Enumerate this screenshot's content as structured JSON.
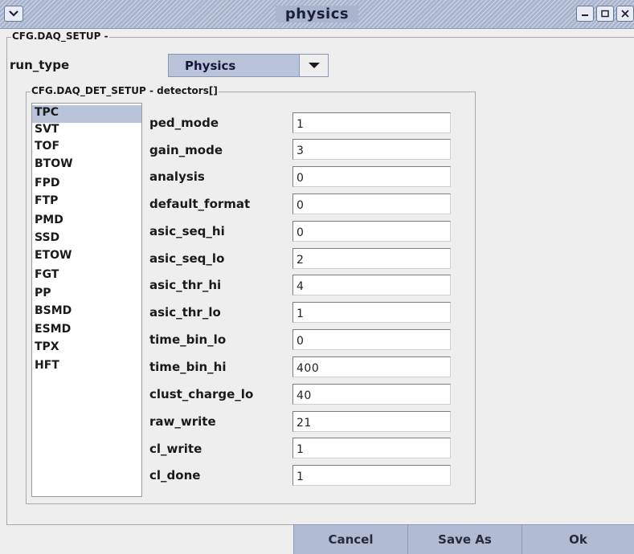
{
  "window": {
    "title": "physics"
  },
  "config": {
    "group_title": "CFG.DAQ_SETUP -",
    "run_type_label": "run_type",
    "run_type_value": "Physics"
  },
  "detector_setup": {
    "group_title": "CFG.DAQ_DET_SETUP - detectors[]",
    "detectors": [
      "TPC",
      "SVT",
      "TOF",
      "BTOW",
      "FPD",
      "FTP",
      "PMD",
      "SSD",
      "ETOW",
      "FGT",
      "PP",
      "BSMD",
      "ESMD",
      "TPX",
      "HFT"
    ],
    "selected": "TPC"
  },
  "params": [
    {
      "label": "ped_mode",
      "value": "1"
    },
    {
      "label": "gain_mode",
      "value": "3"
    },
    {
      "label": "analysis",
      "value": "0"
    },
    {
      "label": "default_format",
      "value": "0"
    },
    {
      "label": "asic_seq_hi",
      "value": "0"
    },
    {
      "label": "asic_seq_lo",
      "value": "2"
    },
    {
      "label": "asic_thr_hi",
      "value": "4"
    },
    {
      "label": "asic_thr_lo",
      "value": "1"
    },
    {
      "label": "time_bin_lo",
      "value": "0"
    },
    {
      "label": "time_bin_hi",
      "value": "400"
    },
    {
      "label": "clust_charge_lo",
      "value": "40"
    },
    {
      "label": "raw_write",
      "value": "21"
    },
    {
      "label": "cl_write",
      "value": "1"
    },
    {
      "label": "cl_done",
      "value": "1"
    }
  ],
  "buttons": {
    "cancel": "Cancel",
    "save_as": "Save As",
    "ok": "Ok"
  },
  "colors": {
    "selection": "#b9c3d9",
    "button_bg": "#b1bcd4",
    "titlebar": "#a9b5cf"
  },
  "icons": {
    "window_menu": "chevron-down-icon",
    "minimize": "minimize-icon",
    "maximize": "maximize-icon",
    "close": "close-icon"
  }
}
